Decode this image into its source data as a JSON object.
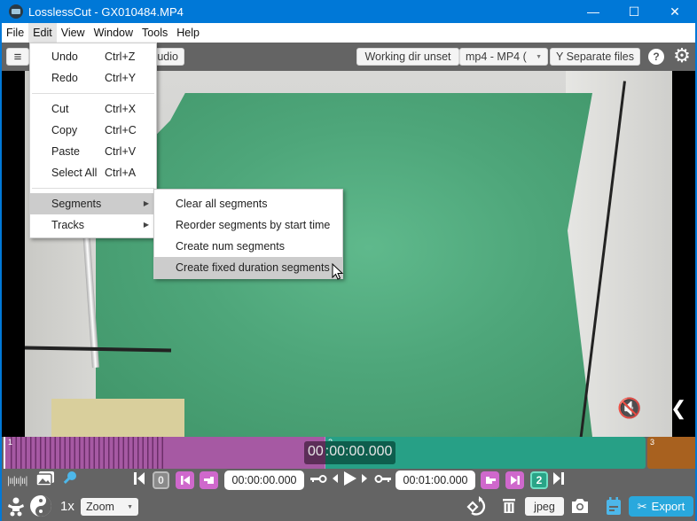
{
  "window": {
    "title": "LosslessCut - GX010484.MP4",
    "controls": {
      "minimize": "—",
      "maximize": "☐",
      "close": "✕"
    }
  },
  "menubar": {
    "items": [
      "File",
      "Edit",
      "View",
      "Window",
      "Tools",
      "Help"
    ],
    "active": "Edit"
  },
  "toolbar": {
    "menu_icon": "≡",
    "audio_label": "udio",
    "working_dir_label": "Working dir unset",
    "format_label": "mp4 - MP4 (",
    "format_caret": "▼",
    "separate_files_label": "Y Separate files",
    "help_icon": "?",
    "settings_icon": "⚙"
  },
  "edit_menu": {
    "items": [
      {
        "label": "Undo",
        "accel": "Ctrl+Z"
      },
      {
        "label": "Redo",
        "accel": "Ctrl+Y"
      },
      {
        "label": "Cut",
        "accel": "Ctrl+X"
      },
      {
        "label": "Copy",
        "accel": "Ctrl+C"
      },
      {
        "label": "Paste",
        "accel": "Ctrl+V"
      },
      {
        "label": "Select All",
        "accel": "Ctrl+A"
      },
      {
        "label": "Segments",
        "submenu": true,
        "highlighted": true
      },
      {
        "label": "Tracks",
        "submenu": true
      }
    ],
    "submenu_arrow": "▶"
  },
  "segments_submenu": {
    "items": [
      {
        "label": "Clear all segments"
      },
      {
        "label": "Reorder segments by start time"
      },
      {
        "label": "Create num segments"
      },
      {
        "label": "Create fixed duration segments",
        "highlighted": true
      }
    ]
  },
  "video": {
    "mute_icon": "🔇",
    "collapse_icon": "❮"
  },
  "timeline": {
    "segments": [
      {
        "number": "1",
        "color": "#a659a3"
      },
      {
        "number": "2",
        "color": "#27a086"
      },
      {
        "number": "3",
        "color": "#a8611f"
      }
    ],
    "current_time_a": "00",
    "current_time_b": ":00:00.000"
  },
  "controls": {
    "jump_start_icon": "⏮",
    "current_segment_start_number": "0",
    "start_time": "00:00:00.000",
    "end_time": "00:01:00.000",
    "current_segment_end_number": "2",
    "zoom_level": "1x",
    "zoom_select": "Zoom",
    "zoom_caret": "▼",
    "capture_format": "jpeg",
    "export_label": "Export",
    "export_icon": "✂"
  },
  "colors": {
    "titlebar": "#0078d7",
    "segment_start_pink": "#cf68cc",
    "segment_end_teal": "#2aa487",
    "export_blue": "#29a8dd",
    "key_blue": "#4db7ea"
  }
}
